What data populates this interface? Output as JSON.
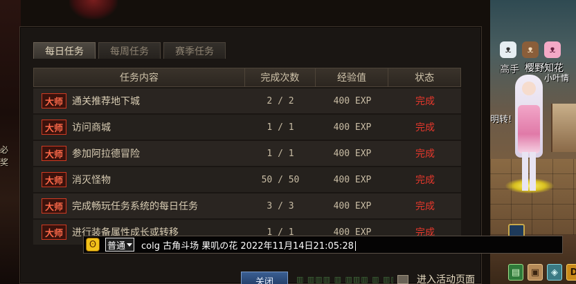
{
  "tabs": [
    {
      "label": "每日任务",
      "active": true
    },
    {
      "label": "每周任务",
      "active": false
    },
    {
      "label": "赛季任务",
      "active": false
    }
  ],
  "table": {
    "headers": [
      "任务内容",
      "完成次数",
      "经验值",
      "状态"
    ],
    "rows": [
      {
        "badge": "大师",
        "task": "通关推荐地下城",
        "count": "2 / 2",
        "exp": "400 EXP",
        "status": "完成"
      },
      {
        "badge": "大师",
        "task": "访问商城",
        "count": "1 / 1",
        "exp": "400 EXP",
        "status": "完成"
      },
      {
        "badge": "大师",
        "task": "参加阿拉德冒险",
        "count": "1 / 1",
        "exp": "400 EXP",
        "status": "完成"
      },
      {
        "badge": "大师",
        "task": "消灭怪物",
        "count": "50 / 50",
        "exp": "400 EXP",
        "status": "完成"
      },
      {
        "badge": "大师",
        "task": "完成畅玩任务系统的每日任务",
        "count": "3 / 3",
        "exp": "400 EXP",
        "status": "完成"
      },
      {
        "badge": "大师",
        "task": "进行装备属性成长或转移",
        "count": "1 / 1",
        "exp": "400 EXP",
        "status": "完成"
      }
    ]
  },
  "chat": {
    "channel": "普通",
    "text": "colg 古角斗场 果叽の花 2022年11月14日21:05:28"
  },
  "bottom": {
    "close_label": "关闭",
    "activity_label": "进入活动页面"
  },
  "world": {
    "name_hand": "高手",
    "name_player": "樱野知花",
    "name_sub": "小叶情",
    "side_left": "必\n奖",
    "side_right": "明转!"
  },
  "colors": {
    "status_complete": "#e8382c",
    "badge_border": "#d23a22",
    "close_button": "#2f4f80"
  }
}
